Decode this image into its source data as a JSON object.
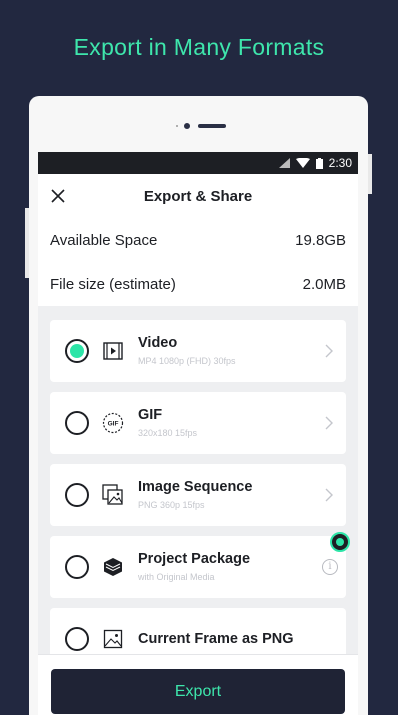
{
  "headline": "Export in Many Formats",
  "status": {
    "time": "2:30"
  },
  "header": {
    "title": "Export & Share"
  },
  "info": {
    "available_label": "Available Space",
    "available_value": "19.8GB",
    "filesize_label": "File size (estimate)",
    "filesize_value": "2.0MB"
  },
  "formats": [
    {
      "title": "Video",
      "subtitle": "MP4 1080p (FHD) 30fps",
      "selected": true,
      "icon": "video-icon"
    },
    {
      "title": "GIF",
      "subtitle": "320x180 15fps",
      "selected": false,
      "icon": "gif-icon"
    },
    {
      "title": "Image Sequence",
      "subtitle": "PNG 360p 15fps",
      "selected": false,
      "icon": "images-icon"
    },
    {
      "title": "Project Package",
      "subtitle": "with Original Media",
      "selected": false,
      "icon": "package-icon"
    },
    {
      "title": "Current Frame as PNG",
      "subtitle": "",
      "selected": false,
      "icon": "image-icon"
    }
  ],
  "gif_icon_text": "GIF",
  "export_label": "Export",
  "colors": {
    "accent": "#3ee6ac",
    "background": "#222840",
    "button": "#1f2335"
  }
}
